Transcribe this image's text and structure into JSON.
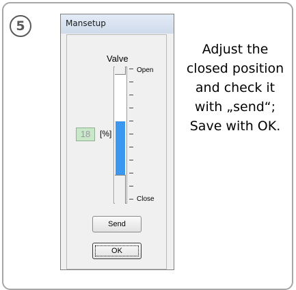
{
  "step": {
    "number": "5"
  },
  "dialog": {
    "title": "Mansetup",
    "valve_label": "Valve",
    "open_label": "Open",
    "close_label": "Close",
    "value": "18",
    "unit": "[%]",
    "slider_fill_fraction": 0.56,
    "send_label": "Send",
    "ok_label": "OK"
  },
  "instruction": {
    "text": "Adjust the closed position and check it with „send“; Save with OK."
  },
  "colors": {
    "slider_fill": "#3c98ee",
    "value_box": "#c9e8c9",
    "border": "#a6a6a6"
  }
}
